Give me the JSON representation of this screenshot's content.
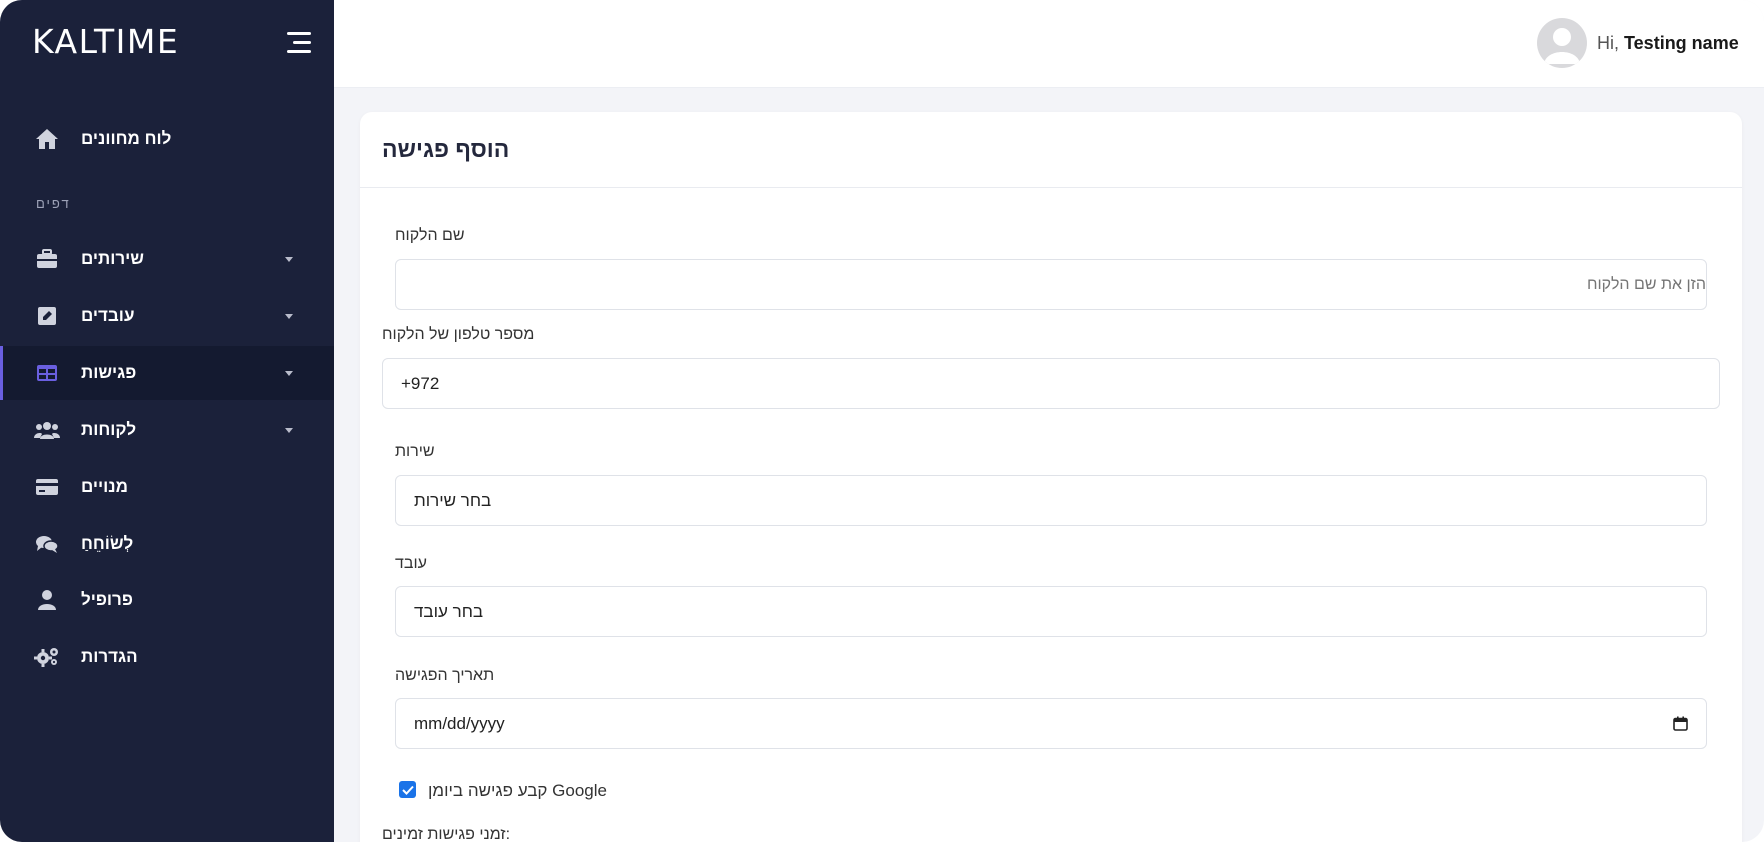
{
  "brand": "KALTIME",
  "sidebar": {
    "dashboard": "לוח מחוונים",
    "section_label": "דפים",
    "items": [
      {
        "label": "שירותים",
        "icon": "briefcase-icon"
      },
      {
        "label": "עובדים",
        "icon": "edit-square-icon"
      },
      {
        "label": "פגישות",
        "icon": "table-icon"
      },
      {
        "label": "לקוחות",
        "icon": "users-icon"
      },
      {
        "label": "מנויים",
        "icon": "credit-card-icon"
      },
      {
        "label": "לְשׂוֹחֵחַ",
        "icon": "chat-icon"
      },
      {
        "label": "פרופיל",
        "icon": "user-icon"
      },
      {
        "label": "הגדרות",
        "icon": "gears-icon"
      }
    ]
  },
  "header": {
    "greeting": "Hi,",
    "user_name": "Testing name"
  },
  "form": {
    "title": "הוסף פגישה",
    "customer_name_label": "שם הלקוח",
    "customer_name_placeholder": "הזן את שם הלקוח",
    "phone_label": "מספר טלפון של הלקוח",
    "phone_value": "+972",
    "service_label": "שירות",
    "service_value": "בחר שירות",
    "employee_label": "עובד",
    "employee_value": "בחר עובד",
    "date_label": "תאריך הפגישה",
    "date_value": "mm/dd/yyyy",
    "google_checkbox_label": "קבע פגישה ביומן Google",
    "google_checked": true,
    "times_label": "זמני פגישות זמינים:"
  },
  "colors": {
    "sidebar_bg": "#1b213a",
    "active_accent": "#6a5fe0",
    "checkbox": "#1a73e8"
  }
}
